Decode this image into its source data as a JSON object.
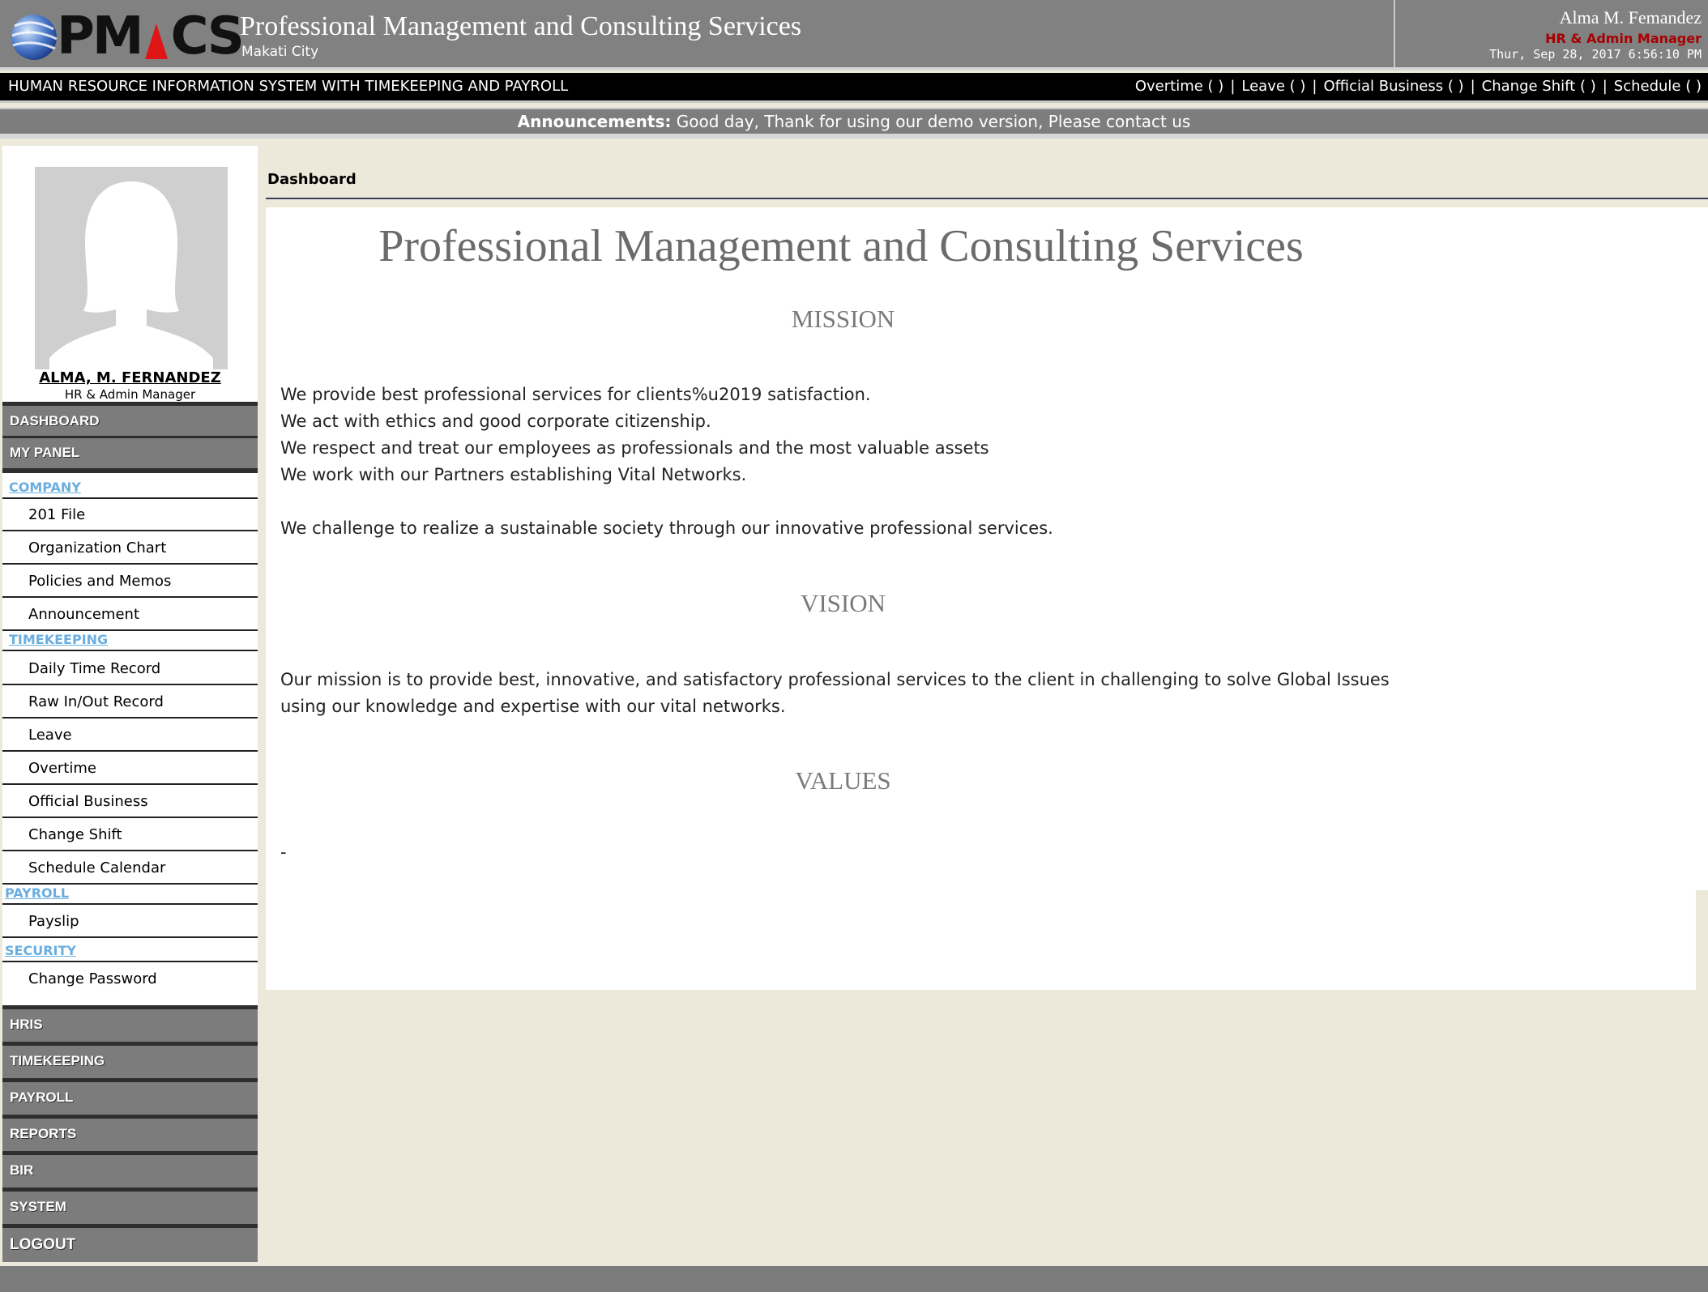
{
  "header": {
    "logo_text_left": "PM",
    "logo_text_right": "CS",
    "company_title": "Professional Management and Consulting Services",
    "company_city": "Makati City",
    "user_name": "Alma M. Femandez",
    "user_role": "HR & Admin Manager",
    "datetime": "Thur, Sep 28, 2017 6:56:10 PM"
  },
  "topnav": {
    "system_name": "HUMAN RESOURCE INFORMATION SYSTEM WITH TIMEKEEPING AND PAYROLL",
    "links": [
      {
        "label": "Overtime ( )"
      },
      {
        "label": "Leave ( )"
      },
      {
        "label": "Official Business ( )"
      },
      {
        "label": "Change Shift ( )"
      },
      {
        "label": "Schedule ( )"
      }
    ],
    "separator": "|"
  },
  "announcement": {
    "label": "Announcements:",
    "text": "Good day, Thank for using our demo version, Please contact us"
  },
  "sidebar": {
    "profile_name": "ALMA, M. FERNANDEZ",
    "profile_role": "HR & Admin Manager",
    "dashboard": "DASHBOARD",
    "my_panel": "MY PANEL",
    "cat_company": "COMPANY",
    "company_items": [
      "201 File",
      "Organization Chart",
      "Policies and Memos",
      "Announcement"
    ],
    "cat_timekeeping": "TIMEKEEPING",
    "timekeeping_items": [
      "Daily Time Record",
      "Raw In/Out Record",
      "Leave",
      "Overtime",
      "Official Business",
      "Change Shift",
      "Schedule Calendar"
    ],
    "cat_payroll": "PAYROLL",
    "payroll_items": [
      "Payslip"
    ],
    "cat_security": "SECURITY",
    "security_items": [
      "Change Password"
    ],
    "modules": [
      "HRIS",
      "TIMEKEEPING",
      "PAYROLL",
      "REPORTS",
      "BIR",
      "SYSTEM",
      "LOGOUT"
    ]
  },
  "main": {
    "breadcrumb": "Dashboard",
    "title": "Professional Management and Consulting Services",
    "mission_heading": "MISSION",
    "mission_lines": [
      "We provide best professional services for clients%u2019 satisfaction.",
      "We act with ethics and good corporate citizenship.",
      "We respect and treat our employees as professionals and the most valuable assets",
      "We work with our Partners establishing Vital Networks."
    ],
    "mission_closing": "We challenge to realize a sustainable society through our innovative professional services.",
    "vision_heading": "VISION",
    "vision_lines": [
      "Our mission is to provide best, innovative, and satisfactory professional services to the client in challenging to solve Global Issues",
      "using our knowledge and expertise with our vital networks."
    ],
    "values_heading": "VALUES",
    "values_text": "-"
  },
  "colors": {
    "header_bg": "#818181",
    "nav_bg": "#000000",
    "role_red": "#a80000",
    "category_blue": "#6aaee0",
    "page_bg": "#ece9da"
  }
}
